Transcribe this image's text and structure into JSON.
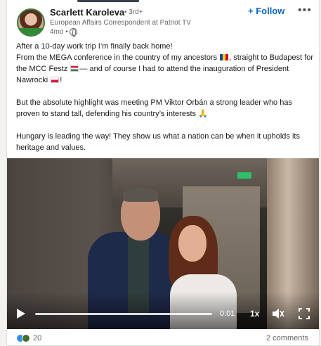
{
  "author": {
    "name": "Scarlett Karoleva",
    "degree": "• 3rd+",
    "headline": "European Affairs Correspondent at Patriot TV",
    "time": "4mo •",
    "follow_label": "+ Follow",
    "more_label": "•••"
  },
  "post": {
    "line1": "After a 10-day work trip I’m finally back home!",
    "line2a": "From the MEGA conference in the country of my ancestors ",
    "line2b": ", straight to Budapest for the MCC Festz ",
    "line2c": "— and of course I had to attend the inauguration of President Nawrocki ",
    "line2d": "!",
    "para2": "But the absolute highlight was meeting PM Viktor Orbán a strong leader who has proven to stand tall, defending his country’s interests 🙏",
    "para3": "Hungary is leading the way! They show us what a nation can be when it upholds its heritage and values."
  },
  "video": {
    "current_time": "0:01",
    "speed": "1x",
    "progress": 0.0,
    "exit_sign": "EXIT"
  },
  "social": {
    "reaction_count": "20",
    "comments": "2 comments"
  },
  "colors": {
    "accent": "#0a66c2",
    "like": "#378fe9",
    "support": "#44712e"
  }
}
